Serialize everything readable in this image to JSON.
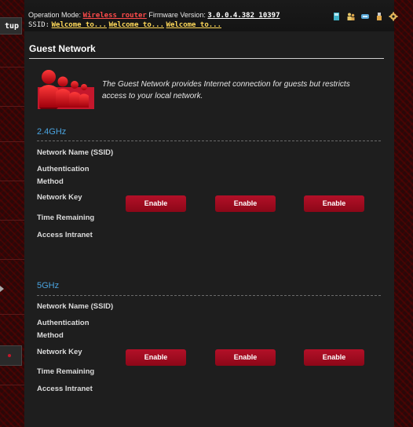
{
  "header": {
    "operation_mode_label": "Operation Mode:",
    "operation_mode_value": "Wireless router",
    "firmware_label": "Firmware Version:",
    "firmware_value": "3.0.0.4.382_10397",
    "ssid_label": "SSID:",
    "ssid_values": [
      "Welcome to...",
      "Welcome to...",
      "Welcome to..."
    ],
    "status_icons": [
      "network-status-icon",
      "users-icon",
      "usb-device-icon",
      "usb-icon",
      "settings-icon"
    ]
  },
  "sidebar": {
    "setup_tab_label": "tup"
  },
  "page": {
    "title": "Guest Network",
    "intro": "The Guest Network provides Internet connection for guests but restricts access to your local network.",
    "icon": "guest-network-icon",
    "accent_color": "#c4172c"
  },
  "bands": [
    {
      "title": "2.4GHz",
      "labels": {
        "ssid": "Network Name (SSID)",
        "auth": "Authentication Method",
        "key": "Network Key",
        "time": "Time Remaining",
        "intranet": "Access Intranet"
      },
      "buttons": [
        "Enable",
        "Enable",
        "Enable"
      ]
    },
    {
      "title": "5GHz",
      "labels": {
        "ssid": "Network Name (SSID)",
        "auth": "Authentication Method",
        "key": "Network Key",
        "time": "Time Remaining",
        "intranet": "Access Intranet"
      },
      "buttons": [
        "Enable",
        "Enable",
        "Enable"
      ]
    }
  ]
}
